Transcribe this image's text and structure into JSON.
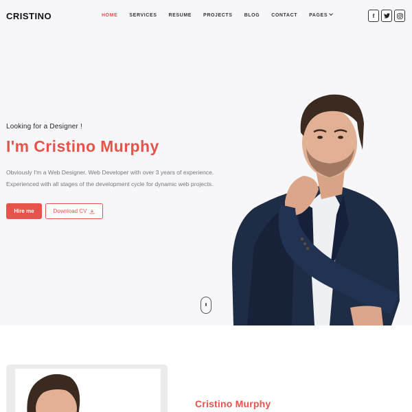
{
  "header": {
    "logo": "CRISTINO",
    "nav": [
      {
        "label": "HOME",
        "active": true
      },
      {
        "label": "SERVICES",
        "active": false
      },
      {
        "label": "RESUME",
        "active": false
      },
      {
        "label": "PROJECTS",
        "active": false
      },
      {
        "label": "BLOG",
        "active": false
      },
      {
        "label": "CONTACT",
        "active": false
      },
      {
        "label": "PAGES",
        "active": false
      }
    ],
    "socials": [
      {
        "icon": "facebook-icon",
        "glyph": "f"
      },
      {
        "icon": "twitter-icon",
        "glyph": ""
      },
      {
        "icon": "instagram-icon",
        "glyph": ""
      }
    ]
  },
  "hero": {
    "intro": "Looking for a Designer !",
    "name": "I'm Cristino Murphy",
    "description": "Obviously I'm a Web Designer. Web Developer with over 3 years of experience. Experienced with all stages of the development cycle for dynamic web projects.",
    "hire_label": "Hire me",
    "cv_label": "Download CV"
  },
  "about": {
    "name": "Cristino Murphy"
  },
  "colors": {
    "accent": "#e5534b",
    "background": "#f7f7f9"
  }
}
